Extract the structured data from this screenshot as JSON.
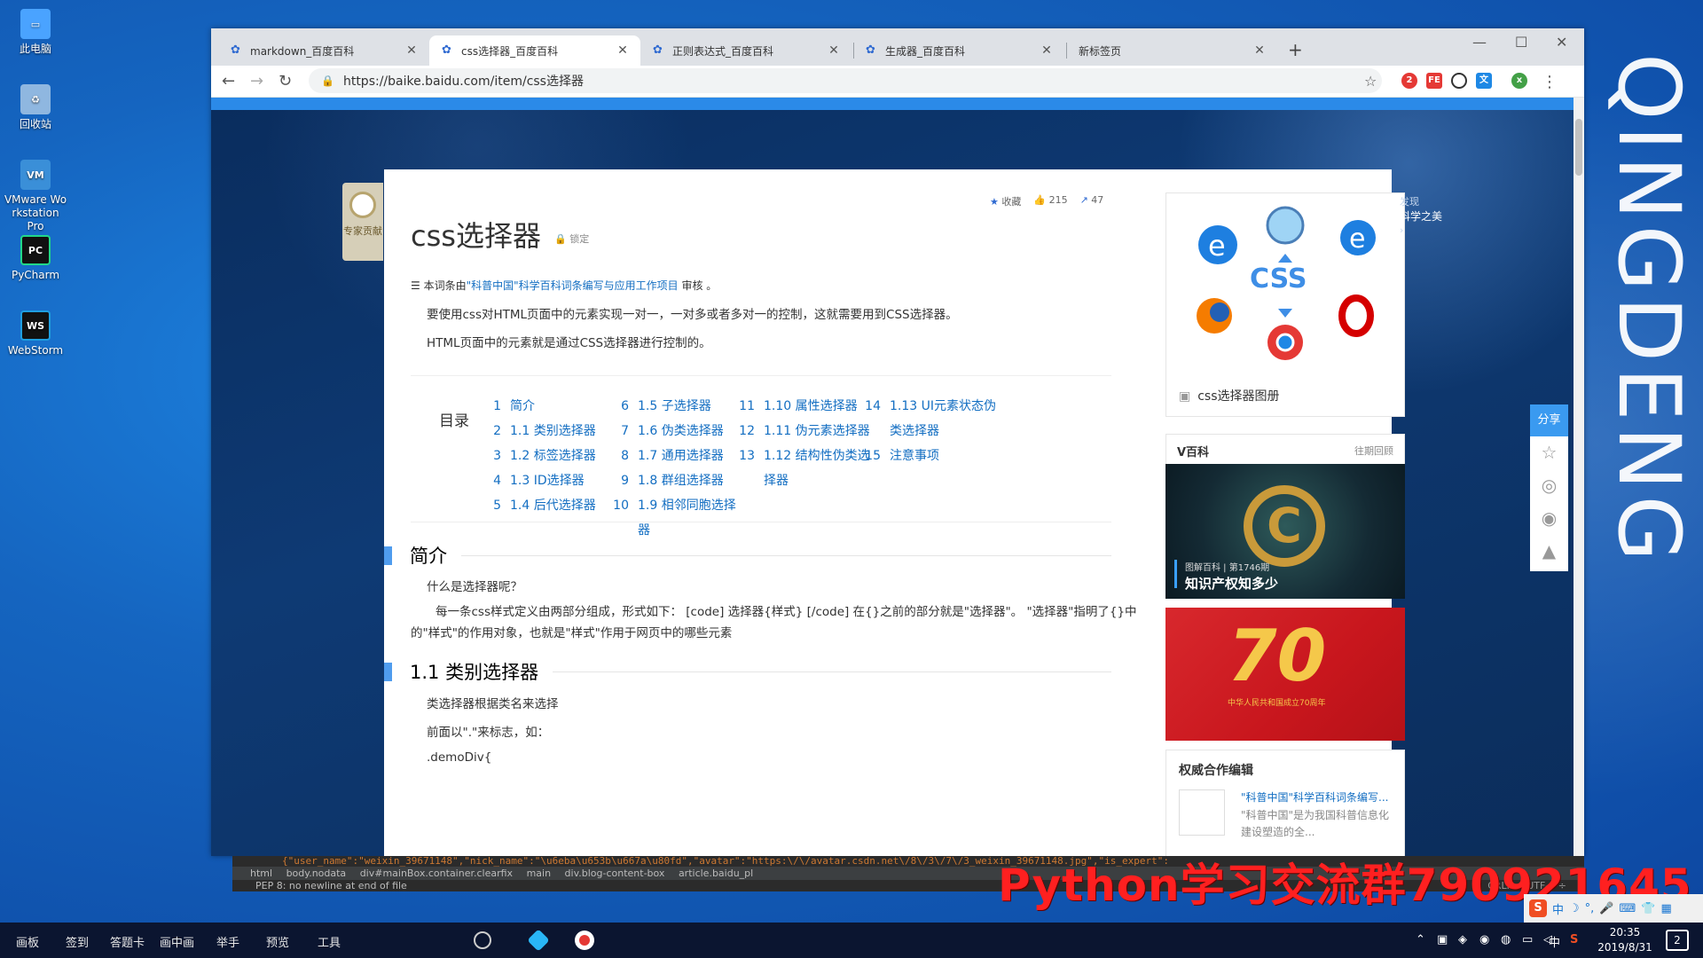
{
  "desktop": {
    "icons": [
      {
        "label": "此电脑",
        "icon": "computer-icon",
        "color": "#4aa3ff"
      },
      {
        "label": "回收站",
        "icon": "recycle-bin-icon",
        "color": "#8fb7e0"
      },
      {
        "label": "VMware Wo rkstation Pro",
        "icon": "vmware-icon",
        "color": "#3a8fd8"
      },
      {
        "label": "PyCharm",
        "icon": "pycharm-icon",
        "color": "#21d789"
      },
      {
        "label": "WebStorm",
        "icon": "webstorm-icon",
        "color": "#1f9ee0"
      }
    ],
    "wallpaper_text": "QINGDENG"
  },
  "browser": {
    "tabs": [
      {
        "title": "markdown_百度百科",
        "active": false
      },
      {
        "title": "css选择器_百度百科",
        "active": true
      },
      {
        "title": "正则表达式_百度百科",
        "active": false
      },
      {
        "title": "生成器_百度百科",
        "active": false
      },
      {
        "title": "新标签页",
        "active": false
      }
    ],
    "url": "https://baike.baidu.com/item/css选择器",
    "extension_badge": "2"
  },
  "page": {
    "expert_label": "专家贡献",
    "title": "css选择器",
    "lock_label": "锁定",
    "stats": {
      "favorite": "收藏",
      "likes": "215",
      "shares": "47"
    },
    "review_prefix": "本词条由",
    "review_link": "\"科普中国\"科学百科词条编写与应用工作项目",
    "review_suffix": "审核 。",
    "intro_1": "要使用css对HTML页面中的元素实现一对一，一对多或者多对一的控制，这就需要用到CSS选择器。",
    "intro_2": "HTML页面中的元素就是通过CSS选择器进行控制的。",
    "toc_title": "目录",
    "toc": [
      [
        {
          "n": "1",
          "label": "简介"
        },
        {
          "n": "2",
          "label": "1.1 类别选择器"
        },
        {
          "n": "3",
          "label": "1.2 标签选择器"
        },
        {
          "n": "4",
          "label": "1.3 ID选择器"
        },
        {
          "n": "5",
          "label": "1.4 后代选择器"
        }
      ],
      [
        {
          "n": "6",
          "label": "1.5 子选择器"
        },
        {
          "n": "7",
          "label": "1.6 伪类选择器"
        },
        {
          "n": "8",
          "label": "1.7 通用选择器"
        },
        {
          "n": "9",
          "label": "1.8 群组选择器"
        },
        {
          "n": "10",
          "label": "1.9 相邻同胞选择器"
        }
      ],
      [
        {
          "n": "11",
          "label": "1.10 属性选择器"
        },
        {
          "n": "12",
          "label": "1.11 伪元素选择器"
        },
        {
          "n": "13",
          "label": "1.12 结构性伪类选择器"
        }
      ],
      [
        {
          "n": "14",
          "label": "1.13 UI元素状态伪类选择器"
        },
        {
          "n": "15",
          "label": "注意事项"
        }
      ]
    ],
    "section_intro": "简介",
    "intro_q": "什么是选择器呢？",
    "intro_body": "每一条css样式定义由两部分组成，形式如下： [code] 选择器{样式} [/code] 在{}之前的部分就是\"选择器\"。 \"选择器\"指明了{}中的\"样式\"的作用对象，也就是\"样式\"作用于网页中的哪些元素",
    "section_1_1": "1.1 类别选择器",
    "s11_p1": "类选择器根据类名来选择",
    "s11_p2": "前面以\".\"来标志，如：",
    "s11_p3": ".demoDiv{",
    "album_caption": "css选择器图册",
    "album_badge": "CSS",
    "vbaike_title": "V百科",
    "vbaike_more": "往期回顾",
    "vbaike_meta": "图解百科 | 第1746期",
    "vbaike_headline": "知识产权知多少",
    "red_banner_num": "70",
    "red_banner_sub": "中华人民共和国成立70周年",
    "coop_title": "权威合作编辑",
    "coop_link": "\"科普中国\"科学百科词条编写...",
    "coop_desc": "\"科普中国\"是为我国科普信息化建设塑造的全...",
    "discover_label": "发现",
    "discover_title": "科学之美",
    "share_label": "分享"
  },
  "ide": {
    "code_line": "{\"user_name\":\"weixin_39671148\",\"nick_name\":\"\\u6eba\\u653b\\u667a\\u80fd\",\"avatar\":\"https:\\/\\/avatar.csdn.net\\/8\\/3\\/7\\/3_weixin_39671148.jpg\",\"is_expert\":",
    "crumbs": [
      "html",
      "body.nodata",
      "div#mainBox.container.clearfix",
      "main",
      "div.blog-content-box",
      "article.baidu_pl"
    ],
    "status": "PEP 8: no newline at end of file",
    "right": "CRLF ÷  UTF-8 ÷"
  },
  "watermark": "Python学习交流群790921645",
  "ime": {
    "lang": "中"
  },
  "taskbar": {
    "items": [
      "画板",
      "签到",
      "答题卡",
      "画中画",
      "举手",
      "预览",
      "工具"
    ],
    "tray_lang": "中",
    "time": "20:35",
    "date": "2019/8/31",
    "notifications": "2"
  }
}
